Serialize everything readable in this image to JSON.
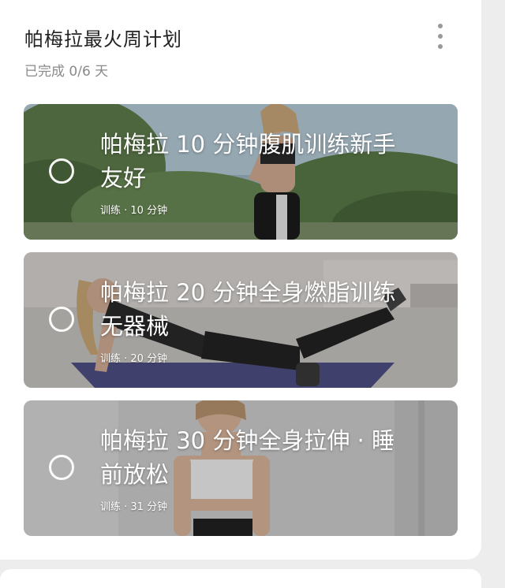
{
  "plan": {
    "title": "帕梅拉最火周计划",
    "progress": "已完成 0/6 天"
  },
  "more_icon": "vertical-ellipsis",
  "workouts": [
    {
      "title": "帕梅拉 10 分钟腹肌训练新手友好",
      "meta": "训练 · 10 分钟",
      "completed": false,
      "scene": "outdoor-greenery"
    },
    {
      "title": "帕梅拉 20 分钟全身燃脂训练 无器械",
      "meta": "训练 · 20 分钟",
      "completed": false,
      "scene": "indoor-mat"
    },
    {
      "title": "帕梅拉 30 分钟全身拉伸 · 睡前放松",
      "meta": "训练 · 31 分钟",
      "completed": false,
      "scene": "indoor-wall"
    }
  ]
}
